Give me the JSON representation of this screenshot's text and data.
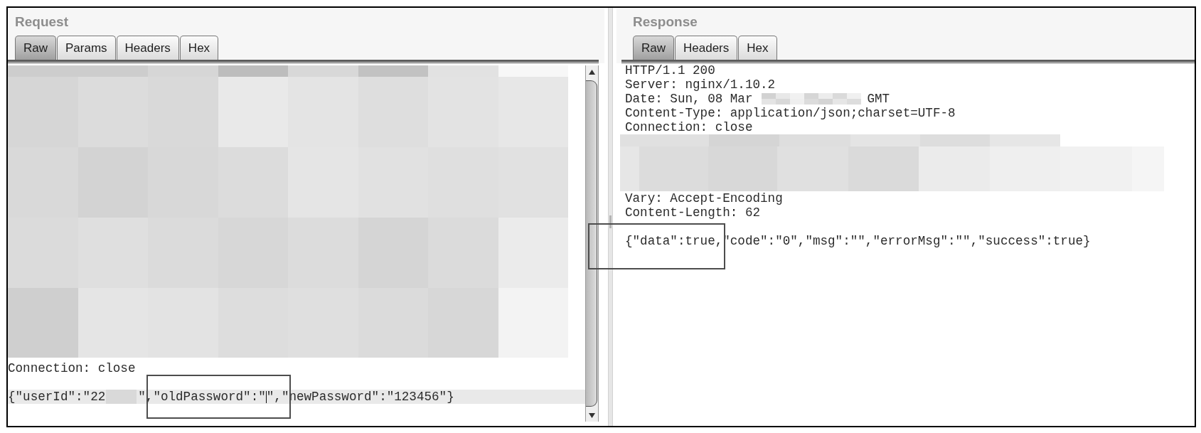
{
  "request": {
    "title": "Request",
    "tabs": [
      {
        "label": "Raw",
        "selected": true
      },
      {
        "label": "Params",
        "selected": false
      },
      {
        "label": "Headers",
        "selected": false
      },
      {
        "label": "Hex",
        "selected": false
      }
    ],
    "lines": [
      {
        "kind": "pixelated"
      },
      {
        "kind": "text",
        "text": "Connection: close"
      },
      {
        "kind": "blank"
      },
      {
        "kind": "parts",
        "highlighted": true,
        "parts": [
          {
            "kind": "text",
            "text": "{\"userId\":\"22"
          },
          {
            "kind": "blanked"
          },
          {
            "kind": "text",
            "text": "\",\"oldPassword\":\""
          },
          {
            "kind": "caret"
          },
          {
            "kind": "text",
            "text": "\",\"newPassword\":\"123456\"}"
          }
        ]
      }
    ]
  },
  "response": {
    "title": "Response",
    "tabs": [
      {
        "label": "Raw",
        "selected": true
      },
      {
        "label": "Headers",
        "selected": false
      },
      {
        "label": "Hex",
        "selected": false
      }
    ],
    "lines": [
      {
        "kind": "text",
        "text": "HTTP/1.1 200"
      },
      {
        "kind": "text",
        "text": "Server: nginx/1.10.2"
      },
      {
        "kind": "parts",
        "parts": [
          {
            "kind": "text",
            "text": "Date: Sun, 08 Mar"
          },
          {
            "kind": "pixelated"
          },
          {
            "kind": "text",
            "text": "GMT"
          }
        ]
      },
      {
        "kind": "text",
        "text": "Content-Type: application/json;charset=UTF-8"
      },
      {
        "kind": "text",
        "text": "Connection: close"
      },
      {
        "kind": "pixelated"
      },
      {
        "kind": "text",
        "text": "Vary: Accept-Encoding"
      },
      {
        "kind": "text",
        "text": "Content-Length: 62"
      },
      {
        "kind": "blank"
      },
      {
        "kind": "text",
        "text": "{\"data\":true,\"code\":\"0\",\"msg\":\"\",\"errorMsg\":\"\",\"success\":true}"
      }
    ]
  }
}
